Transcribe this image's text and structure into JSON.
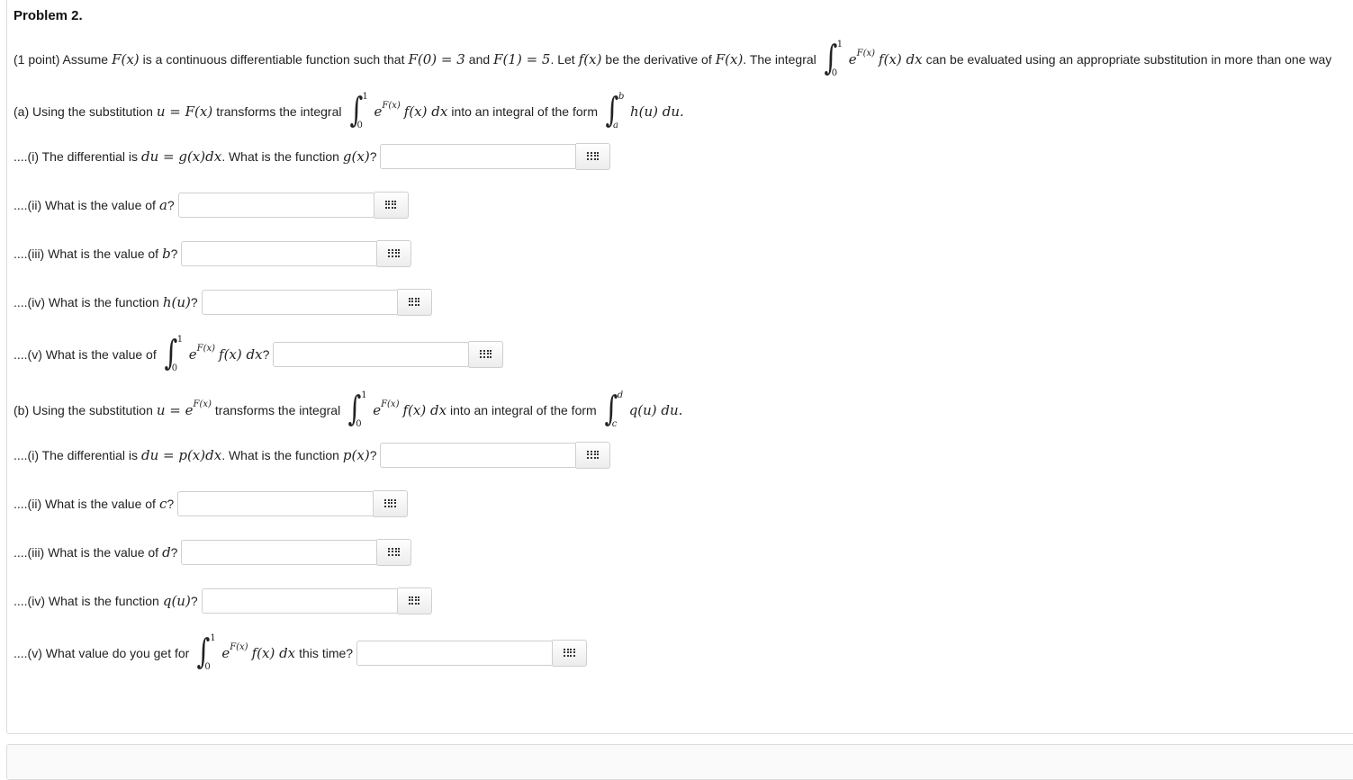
{
  "problem": {
    "title": "Problem 2.",
    "intro": {
      "t1": "(1 point) Assume",
      "Fx": "F(x)",
      "t2": "is a continuous differentiable function such that",
      "F0": "F(0) = 3",
      "t3": "and",
      "F1": "F(1) = 5",
      "t4": ". Let",
      "fx": "f(x)",
      "t5": "be the derivative of",
      "Fx2": "F(x)",
      "t6": ". The integral",
      "t7": "can be evaluated using an appropriate substitution in more than one way"
    },
    "integrand": {
      "e": "e",
      "exp": "F(x)",
      "rest": "f(x) dx",
      "upper": "1",
      "lower": "0"
    },
    "part_a": {
      "t1": "(a) Using the substitution",
      "sub": "u = F(x)",
      "t2": "transforms the integral",
      "t3": "into an integral of the form",
      "form": "h(u) du.",
      "upper": "b",
      "lower": "a",
      "questions": [
        {
          "pre": "....(i) The differential is",
          "math": "du = g(x)dx",
          "post": ". What is the function",
          "math2": "g(x)",
          "end": "?"
        },
        {
          "pre": "....(ii) What is the value of",
          "math": "a",
          "end": "?"
        },
        {
          "pre": "....(iii) What is the value of",
          "math": "b",
          "end": "?"
        },
        {
          "pre": "....(iv) What is the function",
          "math": "h(u)",
          "end": "?"
        },
        {
          "pre": "....(v) What is the value of",
          "end": "?"
        }
      ]
    },
    "part_b": {
      "t1": "(b) Using the substitution",
      "sub": "u = e",
      "sub_exp": "F(x)",
      "t2": "transforms the integral",
      "t3": "into an integral of the form",
      "form": "q(u) du.",
      "upper": "d",
      "lower": "c",
      "questions": [
        {
          "pre": "....(i) The differential is",
          "math": "du = p(x)dx",
          "post": ". What is the function",
          "math2": "p(x)",
          "end": "?"
        },
        {
          "pre": "....(ii) What is the value of",
          "math": "c",
          "end": "?"
        },
        {
          "pre": "....(iii) What is the value of",
          "math": "d",
          "end": "?"
        },
        {
          "pre": "....(iv) What is the function",
          "math": "q(u)",
          "end": "?"
        },
        {
          "pre": "....(v) What value do you get for",
          "end": "this time?"
        }
      ]
    },
    "answers": {
      "a_i": "",
      "a_ii": "",
      "a_iii": "",
      "a_iv": "",
      "a_v": "",
      "b_i": "",
      "b_ii": "",
      "b_iii": "",
      "b_iv": "",
      "b_v": ""
    },
    "icons": {
      "answer_button": "equation-editor-grid-icon"
    }
  }
}
